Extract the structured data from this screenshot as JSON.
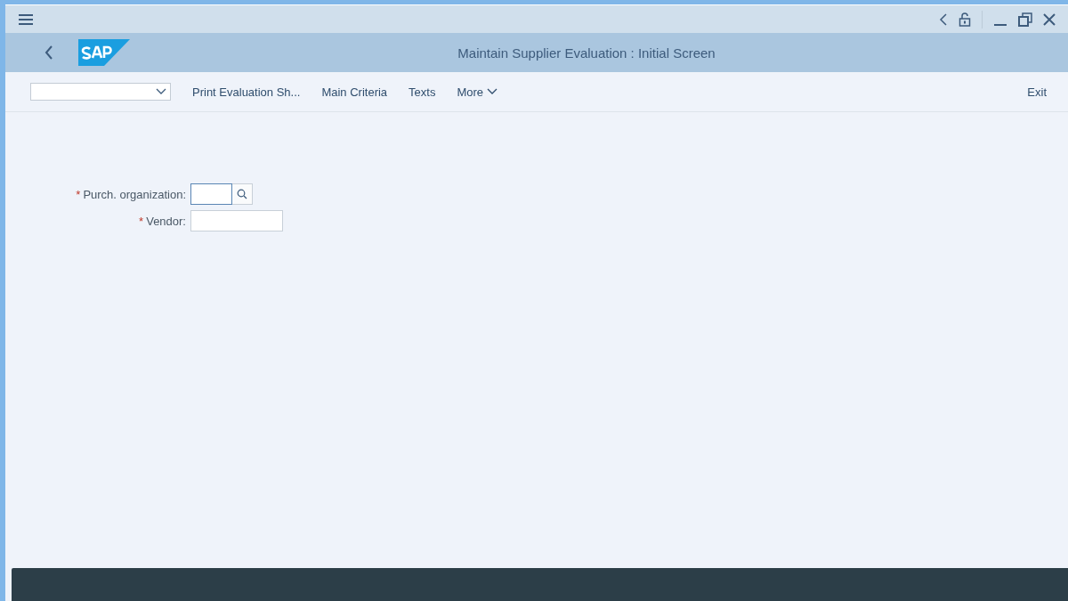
{
  "window": {
    "title": "Maintain Supplier Evaluation : Initial Screen"
  },
  "toolbar": {
    "buttons": [
      {
        "label": "Print Evaluation Sh..."
      },
      {
        "label": "Main Criteria"
      },
      {
        "label": "Texts"
      },
      {
        "label": "More",
        "kind": "menu"
      }
    ],
    "exit": {
      "label": "Exit"
    }
  },
  "form": {
    "fields": [
      {
        "required_mark": "*",
        "label": "Purch. organization:",
        "focused": true,
        "value_help": true
      },
      {
        "required_mark": "*",
        "label": "Vendor:",
        "focused": false,
        "value_help": false
      }
    ]
  },
  "status_bar": {
    "dark": true
  }
}
